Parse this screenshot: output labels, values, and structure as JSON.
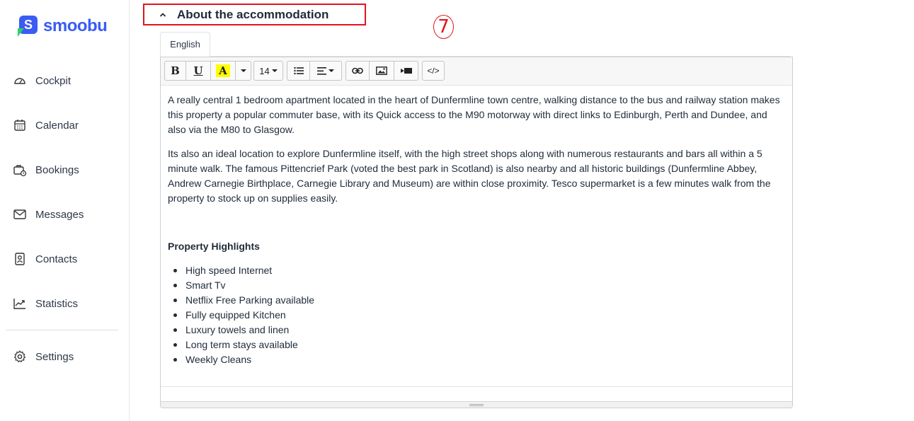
{
  "brand": {
    "name": "smoobu",
    "mark_letter": "S"
  },
  "sidebar": {
    "items": [
      {
        "label": "Cockpit",
        "icon": "gauge-icon"
      },
      {
        "label": "Calendar",
        "icon": "calendar-icon"
      },
      {
        "label": "Bookings",
        "icon": "bookings-icon"
      },
      {
        "label": "Messages",
        "icon": "envelope-icon"
      },
      {
        "label": "Contacts",
        "icon": "contact-card-icon"
      },
      {
        "label": "Statistics",
        "icon": "trend-chart-icon"
      }
    ],
    "settings": {
      "label": "Settings",
      "icon": "gear-icon"
    }
  },
  "section": {
    "title": "About the accommodation",
    "annotation": "7"
  },
  "tabs": [
    {
      "label": "English",
      "active": true
    }
  ],
  "toolbar": {
    "bold": "B",
    "underline": "U",
    "highlight": "A",
    "font_size": "14",
    "code": "</>"
  },
  "content": {
    "paragraphs": [
      "A really central 1 bedroom apartment located in the heart of Dunfermline town centre, walking distance to the bus and railway station makes this property a popular commuter base, with its Quick access to the M90 motorway with direct links to Edinburgh, Perth and Dundee, and also via the M80 to Glasgow.",
      "Its also an ideal location to explore Dunfermline itself, with the high street shops along with numerous restaurants and bars all within a 5 minute walk. The famous Pittencrief Park (voted the best park in Scotland) is also nearby and all historic buildings (Dunfermline Abbey, Andrew Carnegie Birthplace, Carnegie Library and Museum) are within close proximity. Tesco supermarket is a few minutes walk from the property to stock up on supplies easily."
    ],
    "highlights_title": "Property Highlights",
    "highlights": [
      "High speed Internet",
      "Smart Tv",
      "Netflix Free Parking available",
      "Fully equipped Kitchen",
      "Luxury towels and linen",
      "Long term stays available",
      "Weekly Cleans"
    ]
  },
  "colors": {
    "brand_blue": "#3a5cf5",
    "brand_green": "#2ecc71",
    "annotation_red": "#e0141e",
    "highlight_yellow": "#ffff00"
  }
}
